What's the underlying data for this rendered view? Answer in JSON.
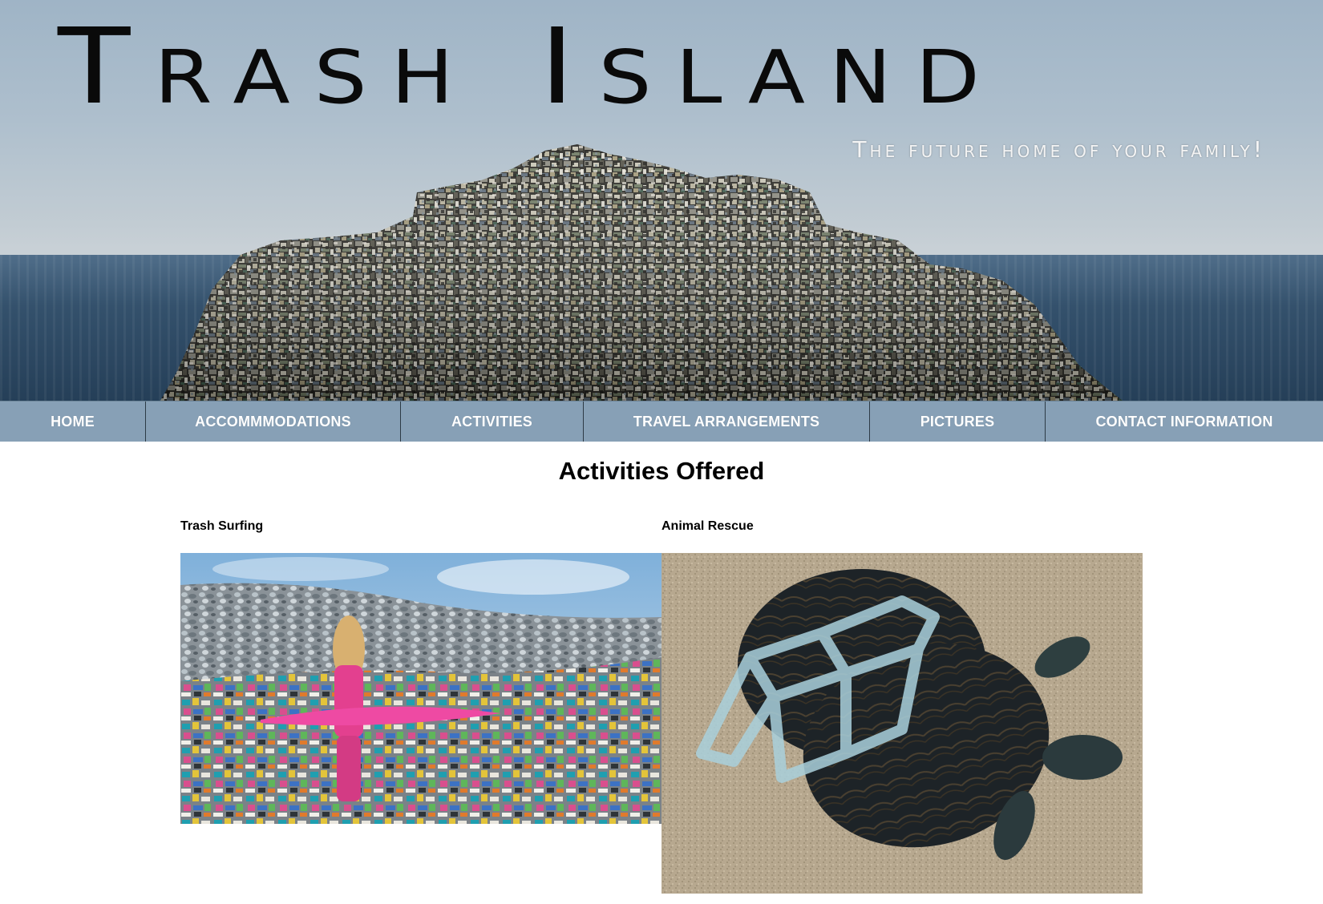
{
  "site": {
    "title": "Trash Island",
    "tagline": "The future home of your family!"
  },
  "nav": {
    "items": [
      {
        "label": "HOME"
      },
      {
        "label": "ACCOMMMODATIONS"
      },
      {
        "label": "ACTIVITIES"
      },
      {
        "label": "TRAVEL ARRANGEMENTS"
      },
      {
        "label": "PICTURES"
      },
      {
        "label": "CONTACT INFORMATION"
      }
    ]
  },
  "main": {
    "heading": "Activities Offered",
    "activities": [
      {
        "label": "Trash Surfing"
      },
      {
        "label": "Animal Rescue"
      }
    ]
  },
  "colors": {
    "nav_background": "#87a0b6",
    "nav_text": "#ffffff",
    "nav_divider": "#2d3b46"
  }
}
